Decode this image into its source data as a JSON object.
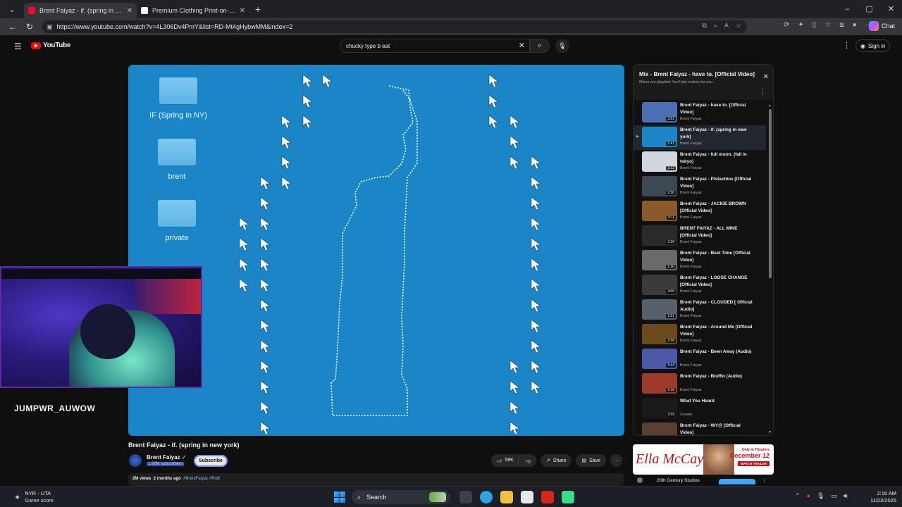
{
  "browser": {
    "tabs": [
      {
        "title": "Brent Faiyaz - if. (spring in new york)",
        "close": "✕",
        "active": true,
        "favicon_color": "#ff0033"
      },
      {
        "title": "Premium Clothing Print-on-Demand",
        "close": "✕",
        "active": false,
        "favicon_color": "#ffffff"
      }
    ],
    "new_tab": "+",
    "url": "https://www.youtube.com/watch?v=4L306Dv4PmY&list=RD-Mt4gHybwMM&index=2",
    "chat_label": "Chat"
  },
  "youtube": {
    "logo_text": "YouTube",
    "search_value": "chucky type b eat",
    "signin_label": "Sign in"
  },
  "desktop_folders": [
    {
      "label": "IF (Spring in NY)"
    },
    {
      "label": "brent"
    },
    {
      "label": "private"
    }
  ],
  "webcam": {
    "streamer_name": "JUMPWR_AUWOW"
  },
  "video": {
    "title": "Brent Faiyaz - if. (spring in new york)",
    "channel": "Brent Faiyaz",
    "subscribers": "1.80M subscribers",
    "subscribe_label": "Subscribe",
    "likes": "58K",
    "share_label": "Share",
    "save_label": "Save",
    "more_label": "···",
    "views": "2M views",
    "age": "2 months ago",
    "tags": "#BrentFaiyaz #RnB"
  },
  "playlist": {
    "title": "Mix - Brent Faiyaz - have to. [Official Video]",
    "subtitle": "Mixes are playlists YouTube makes for you",
    "items": [
      {
        "title": "Brent Faiyaz - have to. [Official Video]",
        "channel": "Brent Faiyaz",
        "duration": "3:51",
        "current": false,
        "thumb_color": "#4b6fb3"
      },
      {
        "title": "Brent Faiyaz - if. (spring in new york)",
        "channel": "Brent Faiyaz",
        "duration": "2:41",
        "current": true,
        "thumb_color": "#1a86c8"
      },
      {
        "title": "Brent Faiyaz - full moon. (fall in tokyo)",
        "channel": "Brent Faiyaz",
        "duration": "3:12",
        "current": false,
        "thumb_color": "#cfd6dc"
      },
      {
        "title": "Brent Faiyaz - Pistachios [Official Video]",
        "channel": "Brent Faiyaz",
        "duration": "2:56",
        "current": false,
        "thumb_color": "#3b4a52"
      },
      {
        "title": "Brent Faiyaz - JACKIE BROWN [Official Video]",
        "channel": "Brent Faiyaz",
        "duration": "3:11",
        "current": false,
        "thumb_color": "#8a5a2b"
      },
      {
        "title": "BRENT FAIYAZ - ALL MINE [Official Video]",
        "channel": "Brent Faiyaz",
        "duration": "3:39",
        "current": false,
        "thumb_color": "#2a2a2a"
      },
      {
        "title": "Brent Faiyaz - Best Time [Official Video]",
        "channel": "Brent Faiyaz",
        "duration": "1:30",
        "current": false,
        "thumb_color": "#6a6a6a"
      },
      {
        "title": "Brent Faiyaz - LOOSE CHANGE [Official Video]",
        "channel": "Brent Faiyaz",
        "duration": "4:06",
        "current": false,
        "thumb_color": "#3a3a3a"
      },
      {
        "title": "Brent Faiyaz - CLOUDED [ Official Audio]",
        "channel": "Brent Faiyaz",
        "duration": "1:51",
        "current": false,
        "thumb_color": "#55606a"
      },
      {
        "title": "Brent Faiyaz - Around Me [Official Video]",
        "channel": "Brent Faiyaz",
        "duration": "2:58",
        "current": false,
        "thumb_color": "#6b4a1e"
      },
      {
        "title": "Brent Faiyaz - Been Away (Audio)",
        "channel": "Brent Faiyaz",
        "duration": "3:44",
        "current": false,
        "thumb_color": "#4a5aa8"
      },
      {
        "title": "Brent Faiyaz - Bluffin (Audio)",
        "channel": "Brent Faiyaz",
        "duration": "3:16",
        "current": false,
        "thumb_color": "#9a3a2a"
      },
      {
        "title": "What You Heard",
        "channel": "Sonder",
        "duration": "3:59",
        "current": false,
        "thumb_color": "#1a1a1a"
      },
      {
        "title": "Brent Faiyaz - WY@ [Official Video]",
        "channel": "Brent Faiyaz",
        "duration": "5:02",
        "current": false,
        "thumb_color": "#5a4030"
      }
    ]
  },
  "ad": {
    "title": "Ella McCay",
    "tagline": "Only In Theaters",
    "date": "December 12",
    "trailer_label": "WATCH TRAILER",
    "advertiser": "20th Century Studios"
  },
  "taskbar": {
    "weather_title": "NYR - UTA",
    "weather_sub": "Game score",
    "search_label": "Search",
    "time": "2:16 AM",
    "date": "11/23/2025",
    "app_colors": [
      "#3a3f4a",
      "#2fa2e0",
      "#f0c040",
      "#e8e8e8",
      "#d8261c",
      "#3ddc84"
    ]
  }
}
